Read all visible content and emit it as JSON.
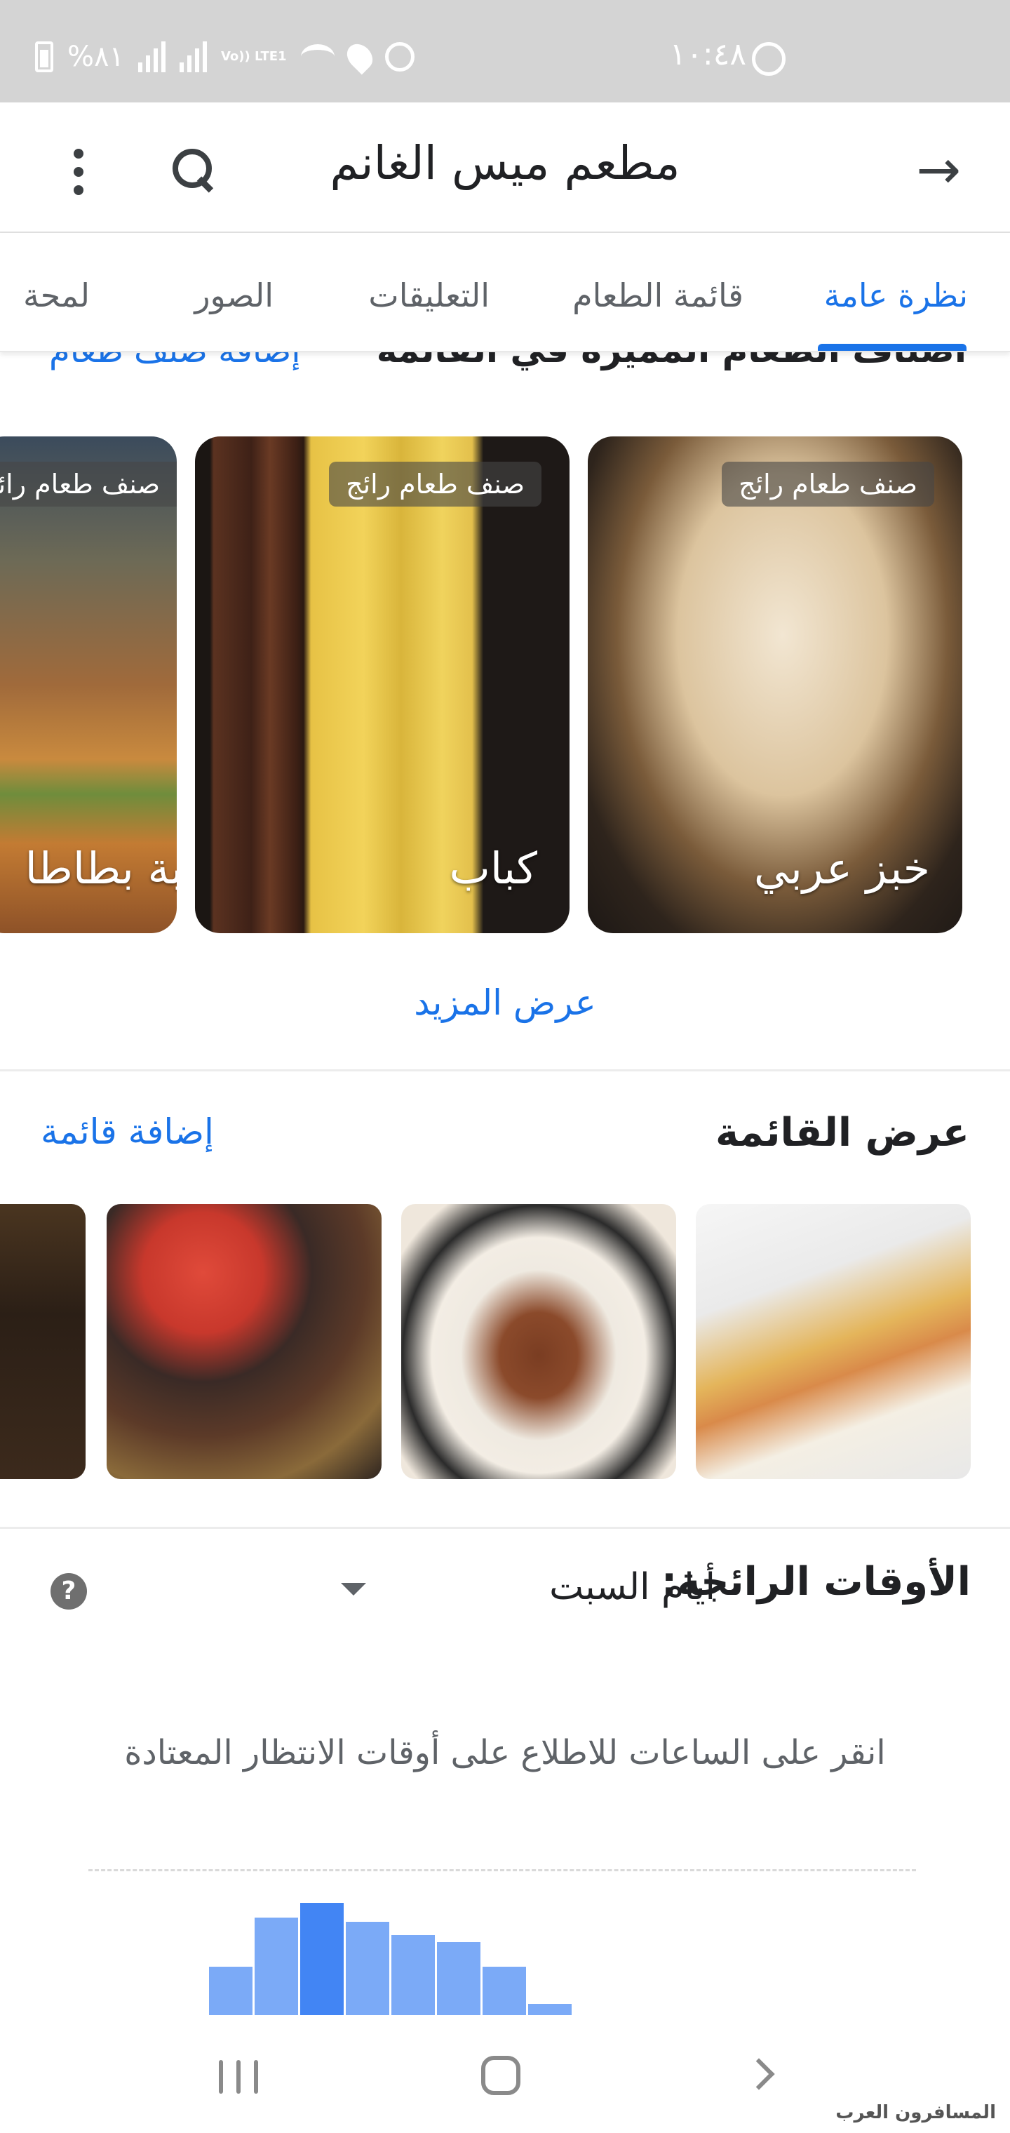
{
  "status_bar": {
    "time": "١٠:٤٨",
    "battery": "%٨١",
    "network": "Vo)) LTE1"
  },
  "app_bar": {
    "title": "مطعم ميس الغانم"
  },
  "tabs": [
    {
      "label": "نظرة عامة",
      "active": true
    },
    {
      "label": "قائمة الطعام",
      "active": false
    },
    {
      "label": "التعليقات",
      "active": false
    },
    {
      "label": "الصور",
      "active": false
    },
    {
      "label": "لمحة",
      "active": false
    }
  ],
  "featured": {
    "heading": "أصناف الطعام المميّزة في القائمة",
    "add_link": "إضافة صنف طعام",
    "dishes": [
      {
        "name": "خبز عربي",
        "badge": "صنف طعام رائج"
      },
      {
        "name": "كباب",
        "badge": "صنف طعام رائج"
      },
      {
        "name": "كبة بطاطا",
        "badge": "صنف طعام رائج"
      }
    ],
    "show_more": "عرض المزيد"
  },
  "menu_section": {
    "title": "عرض القائمة",
    "add_link": "إضافة قائمة"
  },
  "popular_times": {
    "title": "الأوقات الرائجة:",
    "day": "أيام السبت",
    "help_icon": "?",
    "hint": "انقر على الساعات للاطلاع على أوقات الانتظار المعتادة",
    "bars": [
      0.43,
      0.87,
      1.0,
      0.83,
      0.71,
      0.65,
      0.43,
      0.1
    ],
    "highlight_index": 2
  },
  "watermark": "المسافرون العرب",
  "colors": {
    "accent": "#1a73e8",
    "bar": "#7baaf7",
    "bar_current": "#4285f4",
    "status_bar_bg": "#d4d4d4"
  }
}
